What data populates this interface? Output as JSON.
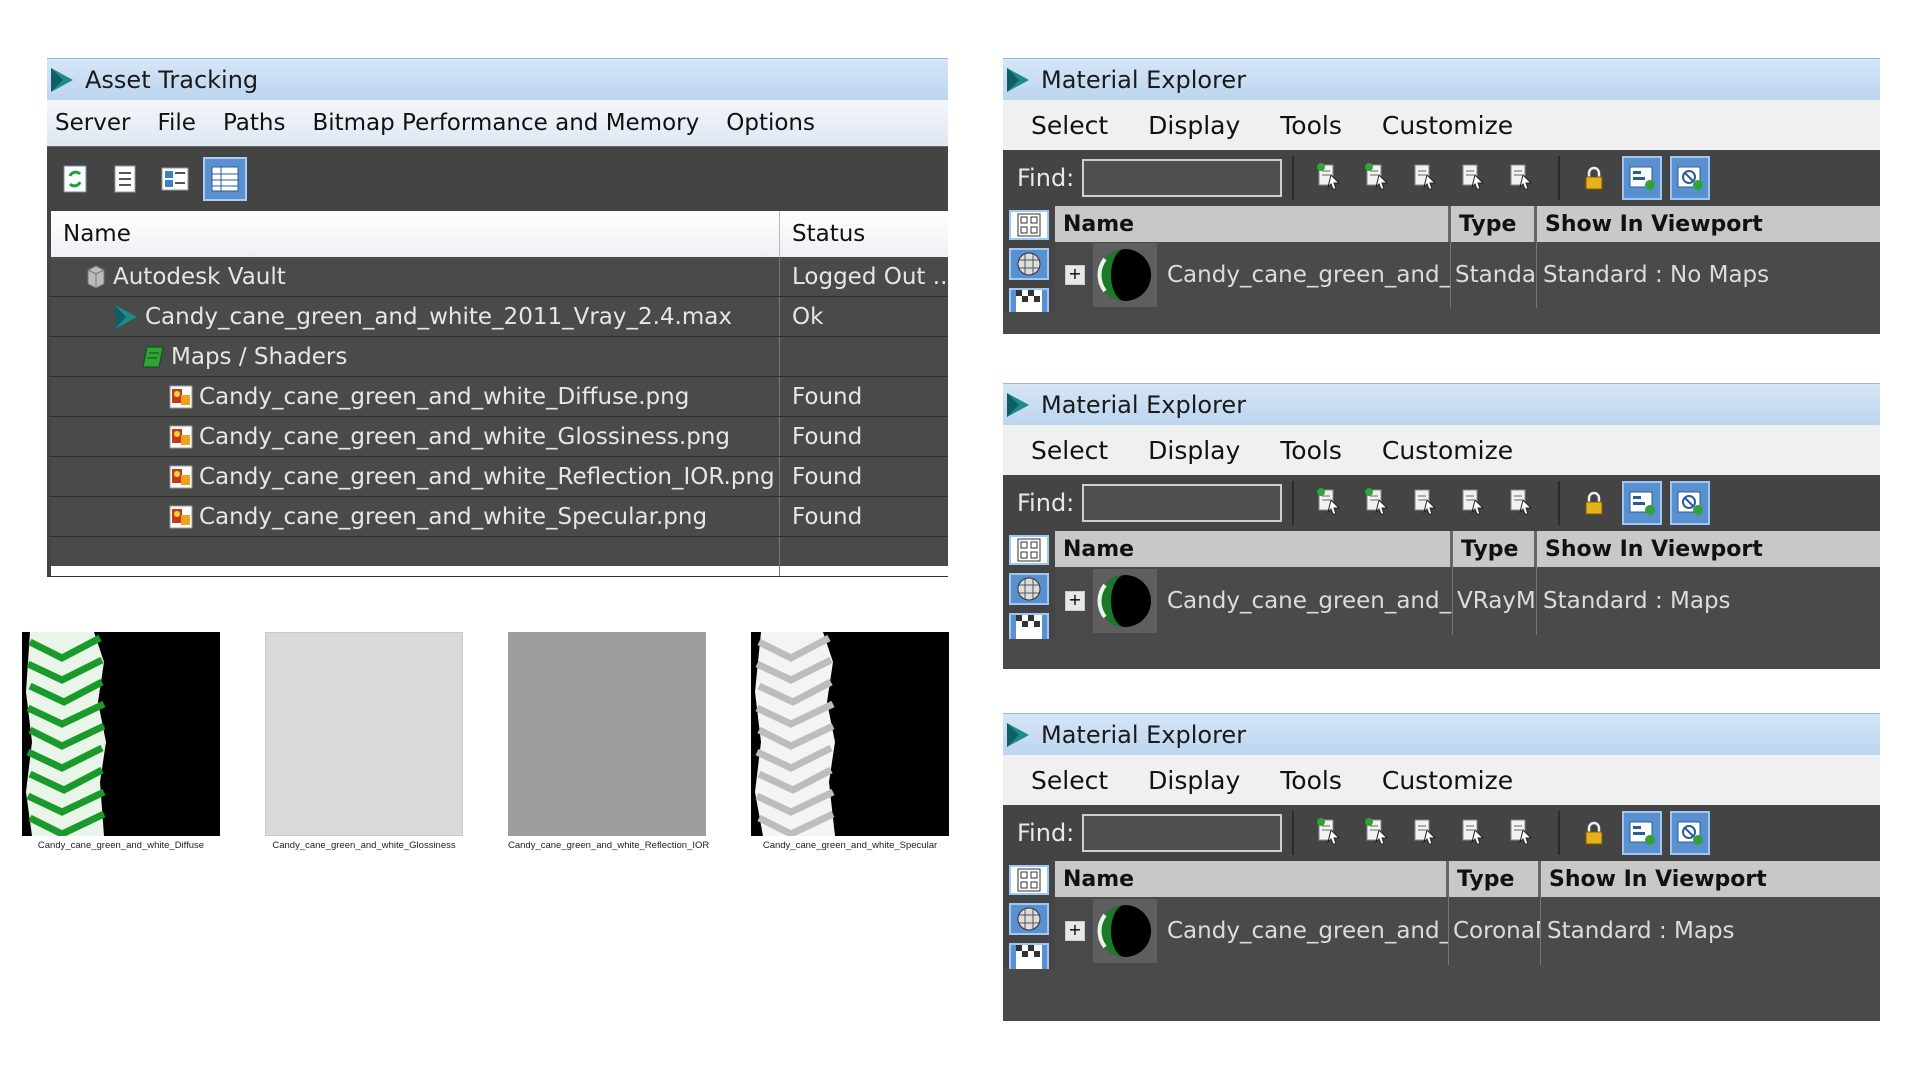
{
  "asset_tracking": {
    "title": "Asset Tracking",
    "menu": [
      "Server",
      "File",
      "Paths",
      "Bitmap Performance and Memory",
      "Options"
    ],
    "toolbar_icons": [
      "refresh-icon",
      "list-icon",
      "thumbnail-icon",
      "table-view-icon"
    ],
    "columns": {
      "name": "Name",
      "status": "Status"
    },
    "rows": [
      {
        "name": "Autodesk Vault",
        "status": "Logged Out ...",
        "icon": "vault-icon",
        "indent": 1
      },
      {
        "name": "Candy_cane_green_and_white_2011_Vray_2.4.max",
        "status": "Ok",
        "icon": "max-file-icon",
        "indent": 2
      },
      {
        "name": "Maps / Shaders",
        "status": "",
        "icon": "maps-folder-icon",
        "indent": 3
      },
      {
        "name": "Candy_cane_green_and_white_Diffuse.png",
        "status": "Found",
        "icon": "bitmap-icon",
        "indent": 4
      },
      {
        "name": "Candy_cane_green_and_white_Glossiness.png",
        "status": "Found",
        "icon": "bitmap-icon",
        "indent": 4
      },
      {
        "name": "Candy_cane_green_and_white_Reflection_IOR.png",
        "status": "Found",
        "icon": "bitmap-icon",
        "indent": 4
      },
      {
        "name": "Candy_cane_green_and_white_Specular.png",
        "status": "Found",
        "icon": "bitmap-icon",
        "indent": 4
      }
    ]
  },
  "thumbnails": [
    {
      "caption": "Candy_cane_green_and_white_Diffuse",
      "kind": "diffuse"
    },
    {
      "caption": "Candy_cane_green_and_white_Glossiness",
      "kind": "glossiness",
      "color": "#d9d9d9"
    },
    {
      "caption": "Candy_cane_green_and_white_Reflection_IOR",
      "kind": "reflection",
      "color": "#9e9e9e"
    },
    {
      "caption": "Candy_cane_green_and_white_Specular",
      "kind": "specular"
    }
  ],
  "material_explorers": [
    {
      "title": "Material Explorer",
      "menu": [
        "Select",
        "Display",
        "Tools",
        "Customize"
      ],
      "find_label": "Find:",
      "columns": {
        "name": "Name",
        "type": "Type",
        "viewport": "Show In Viewport"
      },
      "row": {
        "name": "Candy_cane_green_and_white",
        "type": "Standard",
        "viewport": "Standard : No Maps"
      }
    },
    {
      "title": "Material Explorer",
      "menu": [
        "Select",
        "Display",
        "Tools",
        "Customize"
      ],
      "find_label": "Find:",
      "columns": {
        "name": "Name",
        "type": "Type",
        "viewport": "Show In Viewport"
      },
      "row": {
        "name": "Candy_cane_green_and_white",
        "type": "VRayMtl",
        "viewport": "Standard : Maps"
      }
    },
    {
      "title": "Material Explorer",
      "menu": [
        "Select",
        "Display",
        "Tools",
        "Customize"
      ],
      "find_label": "Find:",
      "columns": {
        "name": "Name",
        "type": "Type",
        "viewport": "Show In Viewport"
      },
      "row": {
        "name": "Candy_cane_green_and_white",
        "type": "CoronaMtl",
        "viewport": "Standard : Maps"
      }
    }
  ],
  "colors": {
    "titlebar": "#c9ddf2",
    "panel": "#4a4a4a",
    "highlight": "#5a8fd0",
    "text_light": "#e6e6e6"
  }
}
